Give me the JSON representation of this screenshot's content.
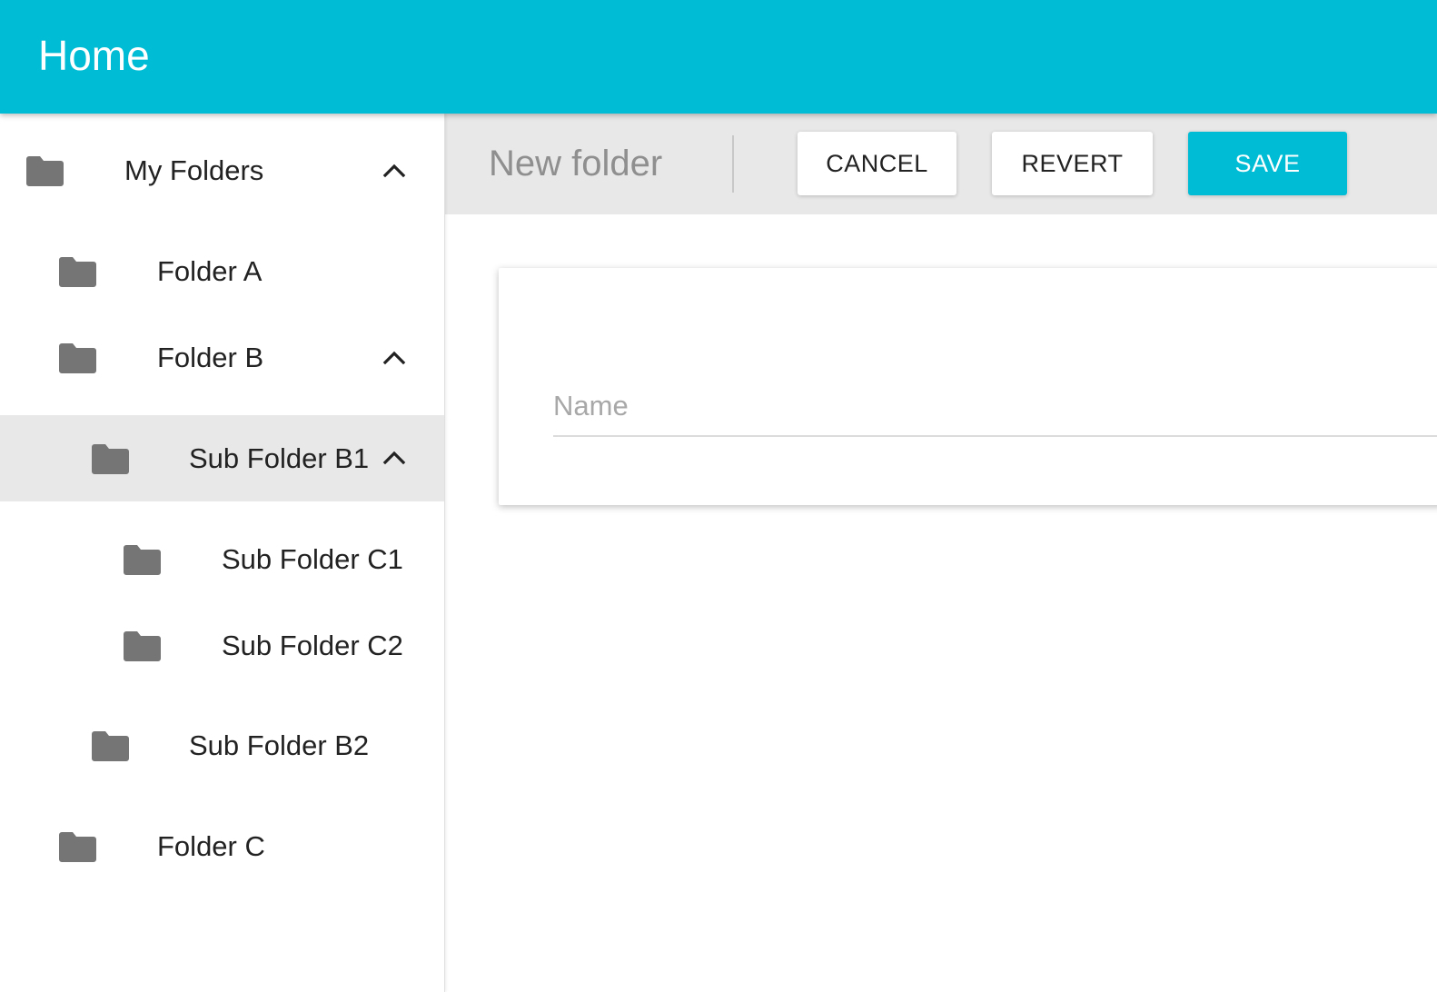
{
  "app_bar": {
    "title": "Home",
    "color": "#00bcd4"
  },
  "sidebar": {
    "items": [
      {
        "label": "My Folders",
        "icon": "folder-icon",
        "expanded": true,
        "selected": false
      },
      {
        "label": "Folder A",
        "icon": "folder-icon",
        "expanded": false,
        "selected": false
      },
      {
        "label": "Folder B",
        "icon": "folder-icon",
        "expanded": true,
        "selected": false
      },
      {
        "label": "Sub Folder B1",
        "icon": "folder-icon",
        "expanded": true,
        "selected": true
      },
      {
        "label": "Sub Folder C1",
        "icon": "folder-icon",
        "expanded": false,
        "selected": false
      },
      {
        "label": "Sub Folder C2",
        "icon": "folder-icon",
        "expanded": false,
        "selected": false
      },
      {
        "label": "Sub Folder B2",
        "icon": "folder-icon",
        "expanded": false,
        "selected": false
      },
      {
        "label": "Folder C",
        "icon": "folder-icon",
        "expanded": false,
        "selected": false
      }
    ],
    "chevron_icon": "chevron-up-icon",
    "selected_color": "#e8e8e8"
  },
  "toolbar": {
    "title": "New folder",
    "cancel_label": "CANCEL",
    "revert_label": "REVERT",
    "save_label": "SAVE",
    "save_color": "#00bcd4"
  },
  "form": {
    "name_placeholder": "Name",
    "name_value": ""
  }
}
